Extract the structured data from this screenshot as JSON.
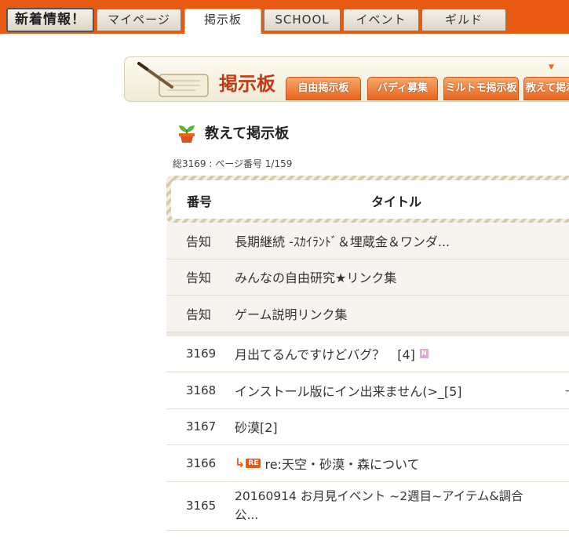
{
  "nav": {
    "tabs": [
      {
        "label": "新着情報！"
      },
      {
        "label": "マイページ"
      },
      {
        "label": "掲示板"
      },
      {
        "label": "SCHOOL"
      },
      {
        "label": "イベント"
      },
      {
        "label": "ギルド"
      }
    ],
    "active": "掲示板"
  },
  "banner": {
    "title": "掲示板",
    "tabs": [
      {
        "label": "自由掲示板"
      },
      {
        "label": "バディ募集"
      },
      {
        "label": "ミルトモ掲示板"
      },
      {
        "label": "教えて掲示"
      }
    ]
  },
  "section": {
    "title": "教えて掲示板"
  },
  "paging": {
    "summary": "総3169 : ページ番号 1/159"
  },
  "table": {
    "headers": {
      "number": "番号",
      "title": "タイトル"
    },
    "notices": [
      {
        "num": "告知",
        "title": "長期継続 -ｽｶｲﾗﾝﾄﾞ＆埋蔵金＆ワンダ..."
      },
      {
        "num": "告知",
        "title": "みんなの自由研究★リンク集"
      },
      {
        "num": "告知",
        "title": "ゲーム説明リンク集"
      }
    ],
    "rows": [
      {
        "num": "3169",
        "title": "月出てるんですけどバグ？　[4]",
        "new_badge": "N"
      },
      {
        "num": "3168",
        "title": "インストール版にイン出来ません(>_[5]",
        "edge": "ｰ"
      },
      {
        "num": "3167",
        "title": "砂漠[2]"
      },
      {
        "num": "3166",
        "title": "re:天空・砂漠・森について",
        "re_label": "RE"
      },
      {
        "num": "3165",
        "title": "20160914 お月見イベント ~2週目~アイテム&調合公..."
      }
    ]
  },
  "colors": {
    "nav_bg": "#e85a12",
    "accent": "#c43a12",
    "subtab": "#e8651e"
  }
}
